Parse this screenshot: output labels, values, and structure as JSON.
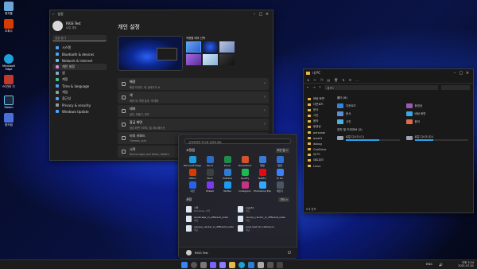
{
  "desktop_icons": [
    "휴지통",
    "오피스",
    "Microsoft Edge",
    "PC관리 기",
    "Steam",
    "한드림"
  ],
  "settings": {
    "title": "설정",
    "user_name": "RIGS Test",
    "user_sub": "로컬 계정",
    "search_placeholder": "설정 찾기",
    "nav": [
      {
        "label": "시스템",
        "color": "#4aa3ff"
      },
      {
        "label": "Bluetooth & devices",
        "color": "#4aa3ff"
      },
      {
        "label": "Network & internet",
        "color": "#5bc0eb"
      },
      {
        "label": "개인 설정",
        "color": "#d18ae8",
        "selected": true
      },
      {
        "label": "앱",
        "color": "#8aa8d9"
      },
      {
        "label": "계정",
        "color": "#4ac08a"
      },
      {
        "label": "Time & language",
        "color": "#4aa3ff"
      },
      {
        "label": "게임",
        "color": "#9a9a9a"
      },
      {
        "label": "접근성",
        "color": "#4aa3ff"
      },
      {
        "label": "Privacy & security",
        "color": "#9a9a9a"
      },
      {
        "label": "Windows Update",
        "color": "#4aa3ff"
      }
    ],
    "page_title": "개인 설정",
    "theme_label": "적용할 테마 선택",
    "rows": [
      {
        "t1": "배경",
        "t2": "배경 이미지, 색, 슬라이드 쇼"
      },
      {
        "t1": "색",
        "t2": "테마 색, 투명 효과, 색 테마"
      },
      {
        "t1": "테마",
        "t2": "설치, 만들기, 관리"
      },
      {
        "t1": "잠금 화면",
        "t2": "잠금 화면 이미지, 앱, 애니메이션"
      },
      {
        "t1": "터치 키보드",
        "t2": "Themes, size"
      },
      {
        "t1": "시작",
        "t2": "Recent apps and items, folders"
      }
    ]
  },
  "explorer": {
    "title": "내 PC",
    "tree": [
      "바탕 화면",
      "다운로드",
      "문서",
      "사진",
      "음악",
      "동영상",
      "personal",
      "asset1",
      "dialog",
      "OneDrive",
      "내 PC",
      "네트워크",
      "Linux"
    ],
    "section_folders": "폴더 (6)",
    "folders": [
      {
        "name": "다운로드",
        "color": "#2e86de"
      },
      {
        "name": "동영상",
        "color": "#9b59b6"
      },
      {
        "name": "문서",
        "color": "#5b8fd1"
      },
      {
        "name": "바탕 화면",
        "color": "#3aa6e8"
      },
      {
        "name": "사진",
        "color": "#4fb0e0"
      },
      {
        "name": "음악",
        "color": "#e06a4a"
      }
    ],
    "section_drives": "장치 및 드라이브 (2)",
    "drives": [
      "로컬 디스크 (C:)",
      "로컬 디스크 (D:)"
    ],
    "drive_used": [
      0.62,
      0.35
    ],
    "status": "8개 항목"
  },
  "start": {
    "search_placeholder": "검색하려면 여기에 입력하세요.",
    "pinned_label": "고정됨",
    "all_apps": "모든 앱 >",
    "pinned": [
      {
        "label": "Microsoft Edge",
        "color": "#1f9be0"
      },
      {
        "label": "Word",
        "color": "#2b6cc4"
      },
      {
        "label": "Excel",
        "color": "#1f8b4c"
      },
      {
        "label": "PowerPoint",
        "color": "#d35230"
      },
      {
        "label": "메일",
        "color": "#3a7bd5"
      },
      {
        "label": "일정",
        "color": "#2f6fd0"
      },
      {
        "label": "Office",
        "color": "#d83b01"
      },
      {
        "label": "Xbox",
        "color": "#3f3f3f"
      },
      {
        "label": "Solitaire",
        "color": "#2d7dd2"
      },
      {
        "label": "Spotify",
        "color": "#1db954"
      },
      {
        "label": "Netflix",
        "color": "#e50914"
      },
      {
        "label": "To Do",
        "color": "#3b82f6"
      },
      {
        "label": "사진",
        "color": "#2563eb"
      },
      {
        "label": "Pinball",
        "color": "#7c3aed"
      },
      {
        "label": "Twitter",
        "color": "#1d9bf0"
      },
      {
        "label": "Instagram",
        "color": "#c13584"
      },
      {
        "label": "Photoshop Express",
        "color": "#31a8ff"
      },
      {
        "label": "계산기",
        "color": "#4b5563"
      }
    ],
    "recommended_label": "권장",
    "more": "기타 >",
    "recommended": [
      {
        "title": "시작",
        "sub": "Windows 시작"
      },
      {
        "title": "rsgn61",
        "sub": "최근"
      },
      {
        "title": "landscape_in_different_scale",
        "sub": "최근"
      },
      {
        "title": "canopy_render_in_different_scale",
        "sub": "최근"
      },
      {
        "title": "canopy_render_in_different_scale",
        "sub": "최근"
      },
      {
        "title": "local_test_for_reference",
        "sub": "최근"
      }
    ],
    "user": "RIGS Test"
  },
  "taskbar": {
    "time": "오후 3:24",
    "date": "2021-07-01",
    "lang": "ENG"
  }
}
